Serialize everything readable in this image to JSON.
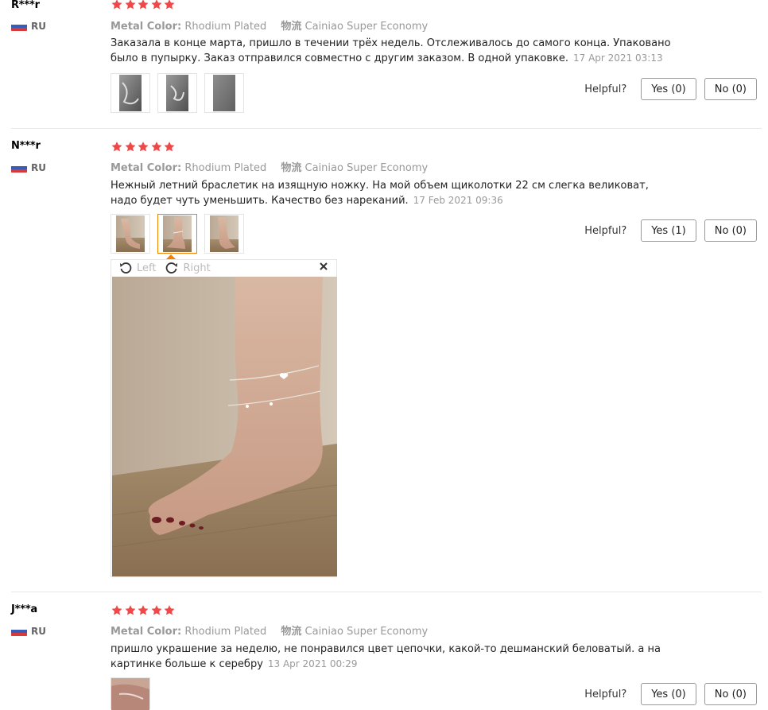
{
  "reviews": [
    {
      "user": "R***r",
      "country": "RU",
      "meta": {
        "color_label": "Metal Color:",
        "color_value": "Rhodium Plated",
        "ship_label": "物流",
        "ship_value": "Cainiao Super Economy"
      },
      "text": "Заказала в конце марта, пришло в течении трёх недель. Отслеживалось до самого конца. Упаковано было в пупырку. Заказ отправился совместно с другим заказом. В одной упаковке.",
      "date": "17 Apr 2021 03:13",
      "helpful": {
        "label": "Helpful?",
        "yes": "Yes (0)",
        "no": "No (0)"
      }
    },
    {
      "user": "N***r",
      "country": "RU",
      "meta": {
        "color_label": "Metal Color:",
        "color_value": "Rhodium Plated",
        "ship_label": "物流",
        "ship_value": "Cainiao Super Economy"
      },
      "text": "Нежный летний браслетик на изящную ножку. На мой объем щиколотки 22 см слегка великоват, надо будет чуть уменьшить. Качество без нареканий.",
      "date": "17 Feb 2021 09:36",
      "helpful": {
        "label": "Helpful?",
        "yes": "Yes (1)",
        "no": "No (0)"
      },
      "viewer": {
        "left": "Left",
        "right": "Right"
      }
    },
    {
      "user": "J***a",
      "country": "RU",
      "meta": {
        "color_label": "Metal Color:",
        "color_value": "Rhodium Plated",
        "ship_label": "物流",
        "ship_value": "Cainiao Super Economy"
      },
      "text": "пришло украшение за неделю, не понравился цвет цепочки, какой-то дешманский беловатый. а на картинке больше к серебру",
      "date": "13 Apr 2021 00:29",
      "helpful": {
        "label": "Helpful?",
        "yes": "Yes (0)",
        "no": "No (0)"
      }
    }
  ],
  "colors": {
    "star": "#f04848",
    "active_thumb": "#f08200"
  },
  "icons": [
    "star-icon",
    "flag-ru-icon",
    "rotate-left-icon",
    "rotate-right-icon",
    "close-icon"
  ]
}
